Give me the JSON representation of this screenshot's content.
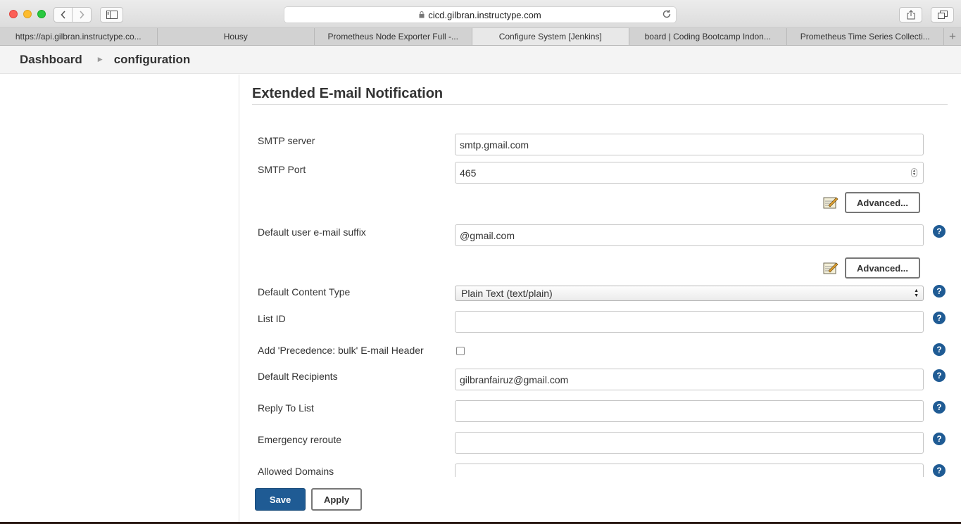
{
  "browser": {
    "url": "cicd.gilbran.instructype.com",
    "tabs": [
      {
        "title": "https://api.gilbran.instructype.co..."
      },
      {
        "title": "Housy"
      },
      {
        "title": "Prometheus Node Exporter Full -..."
      },
      {
        "title": "Configure System [Jenkins]"
      },
      {
        "title": "board | Coding Bootcamp Indon..."
      },
      {
        "title": "Prometheus Time Series Collecti..."
      }
    ],
    "active_tab": 3
  },
  "breadcrumb": {
    "dashboard": "Dashboard",
    "current": "configuration"
  },
  "section": {
    "title": "Extended E-mail Notification"
  },
  "fields": {
    "smtp_server": {
      "label": "SMTP server",
      "value": "smtp.gmail.com"
    },
    "smtp_port": {
      "label": "SMTP Port",
      "value": "465"
    },
    "email_suffix": {
      "label": "Default user e-mail suffix",
      "value": "@gmail.com"
    },
    "content_type": {
      "label": "Default Content Type",
      "value": "Plain Text (text/plain)"
    },
    "list_id": {
      "label": "List ID",
      "value": ""
    },
    "precedence_bulk": {
      "label": "Add 'Precedence: bulk' E-mail Header",
      "checked": false
    },
    "recipients": {
      "label": "Default Recipients",
      "value": "gilbranfairuz@gmail.com"
    },
    "reply_to": {
      "label": "Reply To List",
      "value": ""
    },
    "emergency_reroute": {
      "label": "Emergency reroute",
      "value": ""
    },
    "allowed_domains": {
      "label": "Allowed Domains",
      "value": ""
    }
  },
  "buttons": {
    "advanced": "Advanced...",
    "save": "Save",
    "apply": "Apply",
    "help": "?"
  },
  "colors": {
    "primary": "#1f5b94",
    "help": "#1f5b94"
  }
}
